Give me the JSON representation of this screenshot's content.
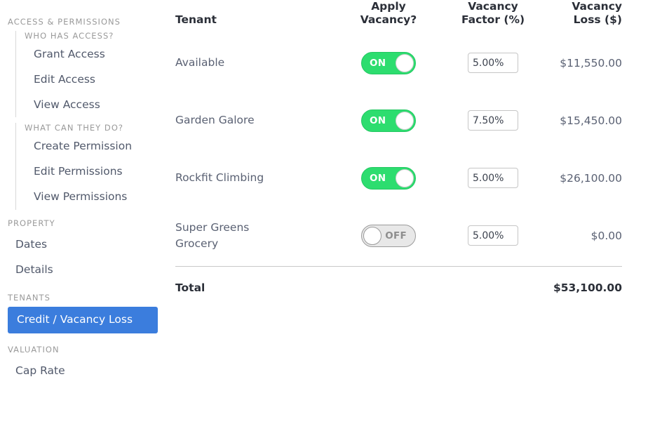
{
  "sidebar": {
    "sections": [
      {
        "heading": "ACCESS & PERMISSIONS",
        "subgroups": [
          {
            "heading": "WHO HAS ACCESS?",
            "items": [
              {
                "label": "Grant Access"
              },
              {
                "label": "Edit Access"
              },
              {
                "label": "View Access"
              }
            ]
          },
          {
            "heading": "WHAT CAN THEY DO?",
            "items": [
              {
                "label": "Create Permission"
              },
              {
                "label": "Edit Permissions"
              },
              {
                "label": "View Permissions"
              }
            ]
          }
        ]
      },
      {
        "heading": "PROPERTY",
        "items": [
          {
            "label": "Dates",
            "selected": false
          },
          {
            "label": "Details",
            "selected": false
          }
        ]
      },
      {
        "heading": "TENANTS",
        "items": [
          {
            "label": "Credit / Vacancy Loss",
            "selected": true
          }
        ]
      },
      {
        "heading": "VALUATION",
        "items": [
          {
            "label": "Cap Rate",
            "selected": false
          }
        ]
      }
    ],
    "selected_color": "#3b7ddd"
  },
  "table": {
    "columns": {
      "tenant": "Tenant",
      "apply_line1": "Apply",
      "apply_line2": "Vacancy?",
      "factor_line1": "Vacancy",
      "factor_line2": "Factor (%)",
      "loss_line1": "Vacancy",
      "loss_line2": "Loss ($)"
    },
    "rows": [
      {
        "tenant": "Available",
        "apply_vacancy": "ON",
        "apply_on": true,
        "vacancy_factor": "5.00%",
        "vacancy_loss": "$11,550.00"
      },
      {
        "tenant": "Garden Galore",
        "apply_vacancy": "ON",
        "apply_on": true,
        "vacancy_factor": "7.50%",
        "vacancy_loss": "$15,450.00"
      },
      {
        "tenant": "Rockfit Climbing",
        "apply_vacancy": "ON",
        "apply_on": true,
        "vacancy_factor": "5.00%",
        "vacancy_loss": "$26,100.00"
      },
      {
        "tenant": "Super Greens Grocery",
        "apply_vacancy": "OFF",
        "apply_on": false,
        "vacancy_factor": "5.00%",
        "vacancy_loss": "$0.00"
      }
    ],
    "total": {
      "label": "Total",
      "value": "$53,100.00"
    },
    "toggle_on_color": "#2ddd6f",
    "toggle_off_color": "#e8e8e8"
  }
}
